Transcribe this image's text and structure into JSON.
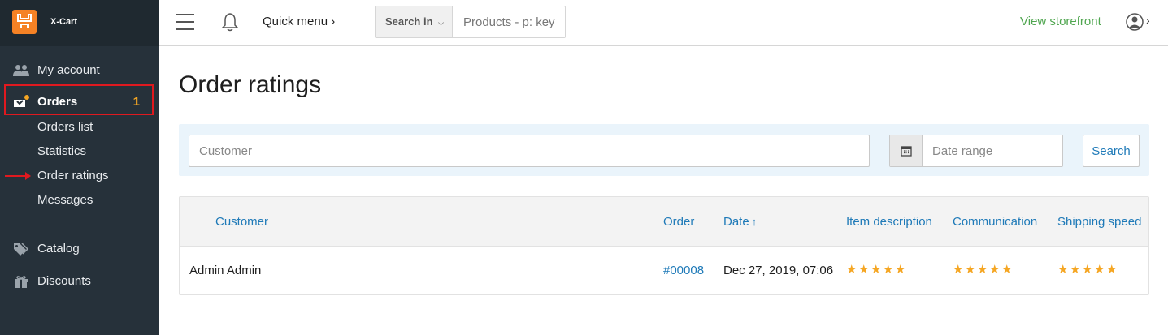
{
  "sidebar": {
    "brand": "X-Cart",
    "items": [
      {
        "label": "My account",
        "icon": "users-icon"
      },
      {
        "label": "Orders",
        "icon": "orders-icon",
        "badge": "1"
      },
      {
        "label": "Catalog",
        "icon": "tags-icon"
      },
      {
        "label": "Discounts",
        "icon": "gift-icon"
      }
    ],
    "orders_sub": [
      {
        "label": "Orders list"
      },
      {
        "label": "Statistics"
      },
      {
        "label": "Order ratings"
      },
      {
        "label": "Messages"
      }
    ]
  },
  "topbar": {
    "quick_menu": "Quick menu",
    "search_in": "Search in",
    "search_placeholder": "Products - p: key",
    "view_storefront": "View storefront"
  },
  "main": {
    "title": "Order ratings",
    "filters": {
      "customer_placeholder": "Customer",
      "date_placeholder": "Date range",
      "search_label": "Search"
    },
    "table": {
      "columns": [
        "Customer",
        "Order",
        "Date",
        "Item description",
        "Communication",
        "Shipping speed"
      ],
      "date_sort_arrow": "↑",
      "rows": [
        {
          "customer": "Admin Admin",
          "order": "#00008",
          "date": "Dec 27, 2019, 07:06",
          "item_description_stars": 5,
          "communication_stars": 5,
          "shipping_speed_stars": 5
        }
      ]
    }
  },
  "colors": {
    "sidebar_bg": "#26313a",
    "accent_orange": "#f58225",
    "link_blue": "#1f7ab8",
    "storefront_green": "#50a650",
    "star": "#f5a623",
    "highlight_red": "#e0191f"
  }
}
